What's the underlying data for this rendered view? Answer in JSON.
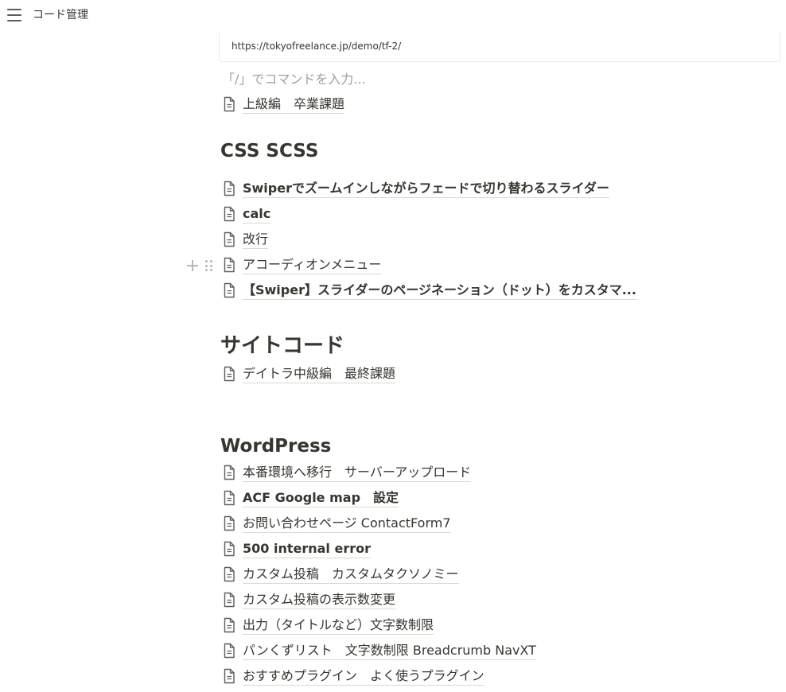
{
  "header": {
    "menu_icon": "hamburger-icon",
    "title": "コード管理"
  },
  "bookmark": {
    "url": "https://tokyofreelance.jp/demo/tf-2/"
  },
  "editor": {
    "placeholder": "「/」でコマンドを入力..."
  },
  "top_pages": [
    {
      "label": "上級編　卒業課題"
    }
  ],
  "sections": {
    "css": {
      "heading": "CSS SCSS",
      "pages": [
        {
          "label": "Swiperでズームインしながらフェードで切り替わるスライダー"
        },
        {
          "label": "calc"
        },
        {
          "label": "改行"
        },
        {
          "label": "アコーディオンメニュー"
        },
        {
          "label": "【Swiper】スライダーのページネーション（ドット）をカスタマ..."
        }
      ]
    },
    "site": {
      "heading": "サイトコード",
      "pages": [
        {
          "label": "デイトラ中級編　最終課題"
        }
      ]
    },
    "wordpress": {
      "heading": "WordPress",
      "pages": [
        {
          "label": "本番環境へ移行　サーバーアップロード"
        },
        {
          "label": "ACF Google map　設定"
        },
        {
          "label": "お問い合わせページ ContactForm7"
        },
        {
          "label": "500 internal error"
        },
        {
          "label": "カスタム投稿　カスタムタクソノミー"
        },
        {
          "label": "カスタム投稿の表示数変更"
        },
        {
          "label": "出力（タイトルなど）文字数制限"
        },
        {
          "label": "パンくずリスト　文字数制限 Breadcrumb NavXT"
        },
        {
          "label": "おすすめプラグイン　よく使うプラグイン"
        }
      ]
    }
  },
  "block_handle": {
    "add_icon": "plus-icon",
    "drag_icon": "drag-handle-icon"
  },
  "page_icon": "document-icon"
}
